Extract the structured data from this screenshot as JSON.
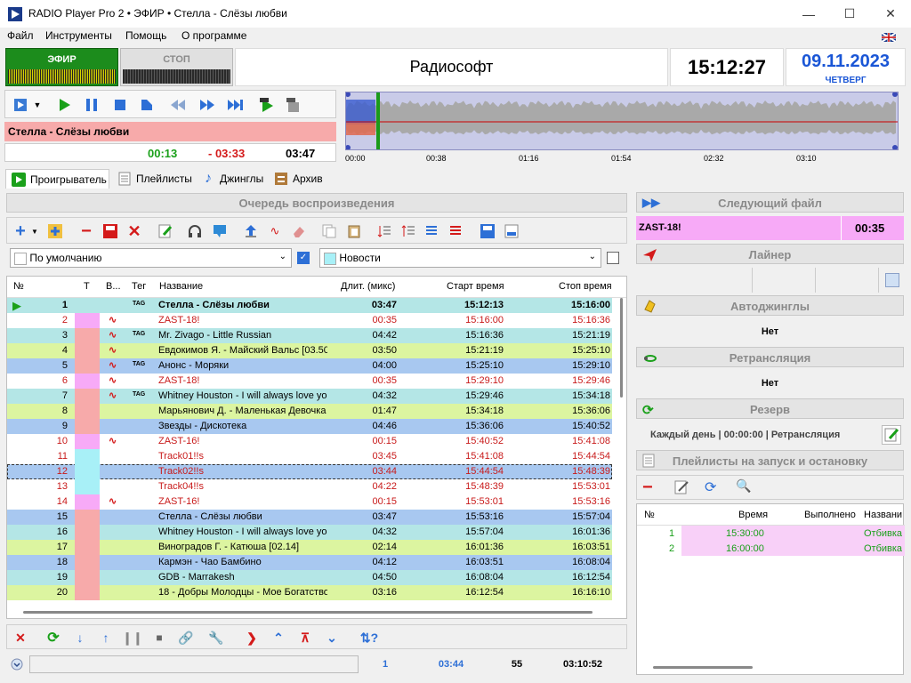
{
  "window": {
    "title": "RADIO Player Pro 2 • ЭФИР • Стелла - Слёзы любви"
  },
  "menu": [
    "Файл",
    "Инструменты",
    "Помощь",
    "О программе"
  ],
  "top": {
    "onair_label": "ЭФИР",
    "stop_label": "СТОП",
    "brand": "Радиософт",
    "clock": "15:12:27",
    "date": "09.11.2023",
    "weekday": "ЧЕТВЕРГ"
  },
  "player": {
    "now_playing": "Стелла - Слёзы любви",
    "elapsed": "00:13",
    "remaining": "- 03:33",
    "duration": "03:47",
    "wave_times": [
      "00:00",
      "00:38",
      "01:16",
      "01:54",
      "02:32",
      "03:10"
    ]
  },
  "tabs": [
    "Проигрыватель",
    "Плейлисты",
    "Джинглы",
    "Архив"
  ],
  "queue": {
    "title": "Очередь воспроизведения",
    "combo_left": "По умолчанию",
    "combo_right": "Новости",
    "columns": [
      "№",
      "Т",
      "В...",
      "Тег",
      "Название",
      "Длит. (микс)",
      "Старт время",
      "Стоп время"
    ],
    "rows": [
      {
        "n": "1",
        "tag": "TAG",
        "name": "Стелла - Слёзы любви",
        "dur": "03:47",
        "start": "15:12:13",
        "stop": "15:16:00",
        "bg": "#b4e6e6",
        "tcol": "#b4e6e6",
        "wave": false,
        "red": false,
        "bold": true,
        "play": true
      },
      {
        "n": "2",
        "tag": "",
        "name": "ZAST-18!",
        "dur": "00:35",
        "start": "15:16:00",
        "stop": "15:16:36",
        "bg": "#ffffff",
        "tcol": "#f7aaf7",
        "wave": true,
        "red": true,
        "bold": false
      },
      {
        "n": "3",
        "tag": "TAG",
        "name": "Mr. Zivago - Little Russian",
        "dur": "04:42",
        "start": "15:16:36",
        "stop": "15:21:19",
        "bg": "#b4e6e6",
        "tcol": "#f7aaaa",
        "wave": true,
        "red": false,
        "bold": false
      },
      {
        "n": "4",
        "tag": "",
        "name": "Евдокимов Я.  - Майский Вальс [03.50",
        "dur": "03:50",
        "start": "15:21:19",
        "stop": "15:25:10",
        "bg": "#dcf5a0",
        "tcol": "#f7aaaa",
        "wave": true,
        "red": false,
        "bold": false
      },
      {
        "n": "5",
        "tag": "TAG",
        "name": "Анонс - Моряки",
        "dur": "04:00",
        "start": "15:25:10",
        "stop": "15:29:10",
        "bg": "#a8c8f0",
        "tcol": "#f7aaaa",
        "wave": true,
        "red": false,
        "bold": false
      },
      {
        "n": "6",
        "tag": "",
        "name": "ZAST-18!",
        "dur": "00:35",
        "start": "15:29:10",
        "stop": "15:29:46",
        "bg": "#ffffff",
        "tcol": "#f7aaf7",
        "wave": true,
        "red": true,
        "bold": false
      },
      {
        "n": "7",
        "tag": "TAG",
        "name": "Whitney Houston - I will always love yo",
        "dur": "04:32",
        "start": "15:29:46",
        "stop": "15:34:18",
        "bg": "#b4e6e6",
        "tcol": "#f7aaaa",
        "wave": true,
        "red": false,
        "bold": false
      },
      {
        "n": "8",
        "tag": "",
        "name": "Марьянович Д.  - Маленькая Девочка",
        "dur": "01:47",
        "start": "15:34:18",
        "stop": "15:36:06",
        "bg": "#dcf5a0",
        "tcol": "#f7aaaa",
        "wave": false,
        "red": false,
        "bold": false
      },
      {
        "n": "9",
        "tag": "",
        "name": "Звезды - Дискотека",
        "dur": "04:46",
        "start": "15:36:06",
        "stop": "15:40:52",
        "bg": "#a8c8f0",
        "tcol": "#f7aaaa",
        "wave": false,
        "red": false,
        "bold": false
      },
      {
        "n": "10",
        "tag": "",
        "name": "ZAST-16!",
        "dur": "00:15",
        "start": "15:40:52",
        "stop": "15:41:08",
        "bg": "#ffffff",
        "tcol": "#f7aaf7",
        "wave": true,
        "red": true,
        "bold": false
      },
      {
        "n": "11",
        "tag": "",
        "name": "Track01!!s",
        "dur": "03:45",
        "start": "15:41:08",
        "stop": "15:44:54",
        "bg": "#ffffff",
        "tcol": "#a8f0f7",
        "wave": false,
        "red": true,
        "bold": false
      },
      {
        "n": "12",
        "tag": "",
        "name": "Track02!!s",
        "dur": "03:44",
        "start": "15:44:54",
        "stop": "15:48:39",
        "bg": "#a8c8f0",
        "tcol": "#a8f0f7",
        "wave": false,
        "red": true,
        "bold": false,
        "sel": true
      },
      {
        "n": "13",
        "tag": "",
        "name": "Track04!!s",
        "dur": "04:22",
        "start": "15:48:39",
        "stop": "15:53:01",
        "bg": "#ffffff",
        "tcol": "#a8f0f7",
        "wave": false,
        "red": true,
        "bold": false
      },
      {
        "n": "14",
        "tag": "",
        "name": "ZAST-16!",
        "dur": "00:15",
        "start": "15:53:01",
        "stop": "15:53:16",
        "bg": "#ffffff",
        "tcol": "#f7aaf7",
        "wave": true,
        "red": true,
        "bold": false
      },
      {
        "n": "15",
        "tag": "",
        "name": "Стелла - Слёзы любви",
        "dur": "03:47",
        "start": "15:53:16",
        "stop": "15:57:04",
        "bg": "#a8c8f0",
        "tcol": "#f7aaaa",
        "wave": false,
        "red": false,
        "bold": false
      },
      {
        "n": "16",
        "tag": "",
        "name": "Whitney Houston - I will always love yo",
        "dur": "04:32",
        "start": "15:57:04",
        "stop": "16:01:36",
        "bg": "#b4e6e6",
        "tcol": "#f7aaaa",
        "wave": false,
        "red": false,
        "bold": false
      },
      {
        "n": "17",
        "tag": "",
        "name": "Виноградов Г.  - Катюша [02.14]",
        "dur": "02:14",
        "start": "16:01:36",
        "stop": "16:03:51",
        "bg": "#dcf5a0",
        "tcol": "#f7aaaa",
        "wave": false,
        "red": false,
        "bold": false
      },
      {
        "n": "18",
        "tag": "",
        "name": "Кармэн - Чао Бамбино",
        "dur": "04:12",
        "start": "16:03:51",
        "stop": "16:08:04",
        "bg": "#a8c8f0",
        "tcol": "#f7aaaa",
        "wave": false,
        "red": false,
        "bold": false
      },
      {
        "n": "19",
        "tag": "",
        "name": "GDB - Marrakesh",
        "dur": "04:50",
        "start": "16:08:04",
        "stop": "16:12:54",
        "bg": "#b4e6e6",
        "tcol": "#f7aaaa",
        "wave": false,
        "red": false,
        "bold": false
      },
      {
        "n": "20",
        "tag": "",
        "name": "18 - Добры Молодцы - Мое Богатство",
        "dur": "03:16",
        "start": "16:12:54",
        "stop": "16:16:10",
        "bg": "#dcf5a0",
        "tcol": "#f7aaaa",
        "wave": false,
        "red": false,
        "bold": false
      }
    ]
  },
  "status": {
    "index": "1",
    "time": "03:44",
    "count": "55",
    "total": "03:10:52"
  },
  "right": {
    "next_title": "Следующий файл",
    "next_file": "ZAST-18!",
    "next_dur": "00:35",
    "liner_title": "Лайнер",
    "autojingles_title": "Автоджинглы",
    "autojingles_value": "Нет",
    "relay_title": "Ретрансляция",
    "relay_value": "Нет",
    "reserve_title": "Резерв",
    "reserve_value": "Каждый день | 00:00:00 | Ретрансляция",
    "startstop_title": "Плейлисты на запуск и остановку",
    "pl_columns": [
      "№",
      "Время",
      "Выполнено",
      "Названи"
    ],
    "pl_rows": [
      {
        "n": "1",
        "time": "15:30:00",
        "done": "",
        "name": "Отбивка"
      },
      {
        "n": "2",
        "time": "16:00:00",
        "done": "",
        "name": "Отбивка"
      }
    ]
  }
}
